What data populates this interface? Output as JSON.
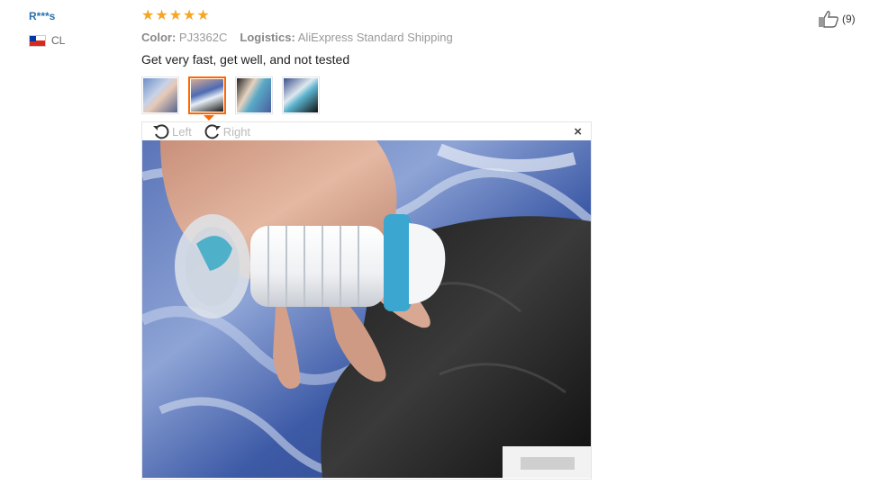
{
  "reviewer": {
    "name": "R***s",
    "country_code": "CL",
    "flag_icon": "chile-flag-icon"
  },
  "rating": {
    "stars": 5,
    "star_glyph": "★"
  },
  "meta": {
    "color_label": "Color:",
    "color_value": "PJ3362C",
    "logistics_label": "Logistics:",
    "logistics_value": "AliExpress Standard Shipping"
  },
  "review": {
    "text": "Get very fast, get well, and not tested"
  },
  "thumbnails": [
    {
      "name": "review-photo-thumbnail-1",
      "active": false
    },
    {
      "name": "review-photo-thumbnail-2",
      "active": true
    },
    {
      "name": "review-photo-thumbnail-3",
      "active": false
    },
    {
      "name": "review-photo-thumbnail-4",
      "active": false
    }
  ],
  "viewer": {
    "rotate_left_label": "Left",
    "rotate_right_label": "Right",
    "close_glyph": "×"
  },
  "helpful": {
    "count_label": "(9)",
    "icon": "thumbs-up-icon"
  },
  "colors": {
    "star": "#f5a623",
    "username": "#2d6fae",
    "active_border": "#ff6600"
  }
}
